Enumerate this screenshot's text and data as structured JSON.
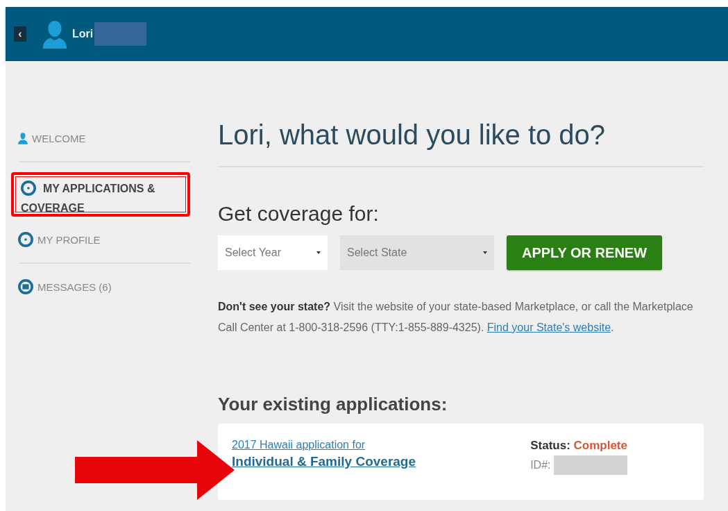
{
  "header": {
    "back_label": "‹",
    "user_name": "Lori"
  },
  "sidebar": {
    "items": [
      {
        "label": "WELCOME",
        "kind": "person",
        "selected": false,
        "divider": true
      },
      {
        "label": "MY APPLICATIONS & COVERAGE",
        "kind": "circle",
        "selected": true,
        "divider": false
      },
      {
        "label": "MY PROFILE",
        "kind": "circle",
        "selected": false,
        "divider": true
      },
      {
        "label": "MESSAGES (6)",
        "kind": "mail",
        "selected": false,
        "divider": false
      }
    ]
  },
  "main": {
    "title": "Lori, what would you like to do?",
    "coverage_heading": "Get coverage for:",
    "year_select": {
      "placeholder": "Select Year"
    },
    "state_select": {
      "placeholder": "Select State"
    },
    "apply_button": "APPLY OR RENEW",
    "note": "**Don't see your state?** Visit the website of your state-based Marketplace, or call the Marketplace Call Center at 1-800-318-2596 (TTY:1-855-889-4325).",
    "note_link": "Find your State's website",
    "note_end": ".",
    "applications_heading": "Your existing applications:",
    "applications": [
      {
        "title_line1": "2017 Hawaii application for",
        "title_line2": "Individual & Family Coverage",
        "status_label": "Status:",
        "status": "Complete",
        "id_label": "ID#:"
      }
    ]
  }
}
